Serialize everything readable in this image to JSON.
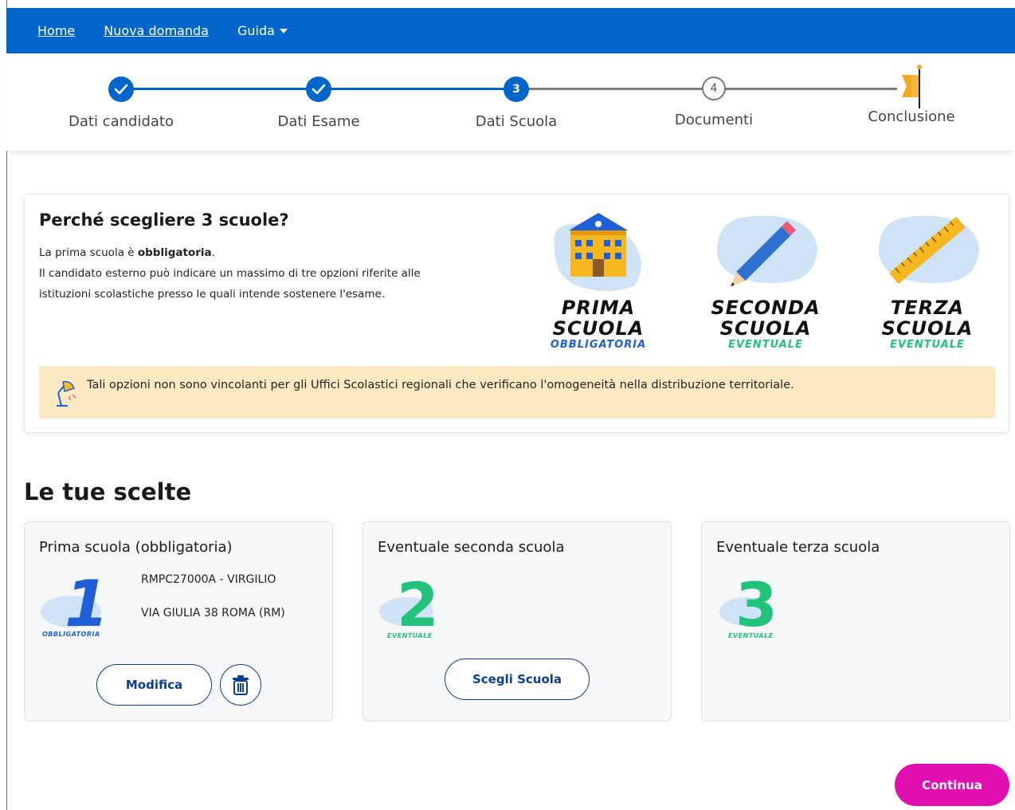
{
  "nav": {
    "links": [
      "Home",
      "Nuova domanda"
    ],
    "guida": "Guida"
  },
  "stepper": {
    "steps": [
      {
        "label": "Dati candidato",
        "status": "done"
      },
      {
        "label": "Dati Esame",
        "status": "done"
      },
      {
        "label": "Dati Scuola",
        "status": "current",
        "number": "3"
      },
      {
        "label": "Documenti",
        "status": "todo",
        "number": "4"
      },
      {
        "label": "Conclusione",
        "status": "todo"
      }
    ]
  },
  "info": {
    "title": "Perché scegliere 3 scuole?",
    "line1_pre": "La prima scuola è ",
    "line1_bold": "obbligatoria",
    "line1_post": ".",
    "line2": "Il candidato esterno può indicare un massimo di tre opzioni riferite alle istituzioni scolastiche presso le quali intende sostenere l'esame.",
    "stickers": [
      {
        "w1": "PRIMA",
        "w2": "SCUOLA",
        "sub": "OBBLIGATORIA"
      },
      {
        "w1": "SECONDA",
        "w2": "SCUOLA",
        "sub": "EVENTUALE"
      },
      {
        "w1": "TERZA",
        "w2": "SCUOLA",
        "sub": "EVENTUALE"
      }
    ],
    "alert": "Tali opzioni non sono vincolanti per gli Uffici Scolastici regionali che verificano l'omogeneità nella distribuzione territoriale."
  },
  "choices": {
    "title": "Le tue scelte",
    "cards": [
      {
        "title": "Prima scuola (obbligatoria)",
        "number": "1",
        "tag": "OBBLIGATORIA",
        "school_code": "RMPC27000A - VIRGILIO",
        "school_address": "VIA GIULIA 38 ROMA (RM)",
        "button": "Modifica"
      },
      {
        "title": "Eventuale seconda scuola",
        "number": "2",
        "tag": "EVENTUALE",
        "button": "Scegli Scuola"
      },
      {
        "title": "Eventuale terza scuola",
        "number": "3",
        "tag": "EVENTUALE"
      }
    ]
  },
  "continue": "Continua",
  "colors": {
    "primary": "#0066cc",
    "alert_bg": "#fde9c1",
    "continue": "#e20fb0",
    "green": "#22c27a",
    "blue_number": "#1e5fd8"
  }
}
